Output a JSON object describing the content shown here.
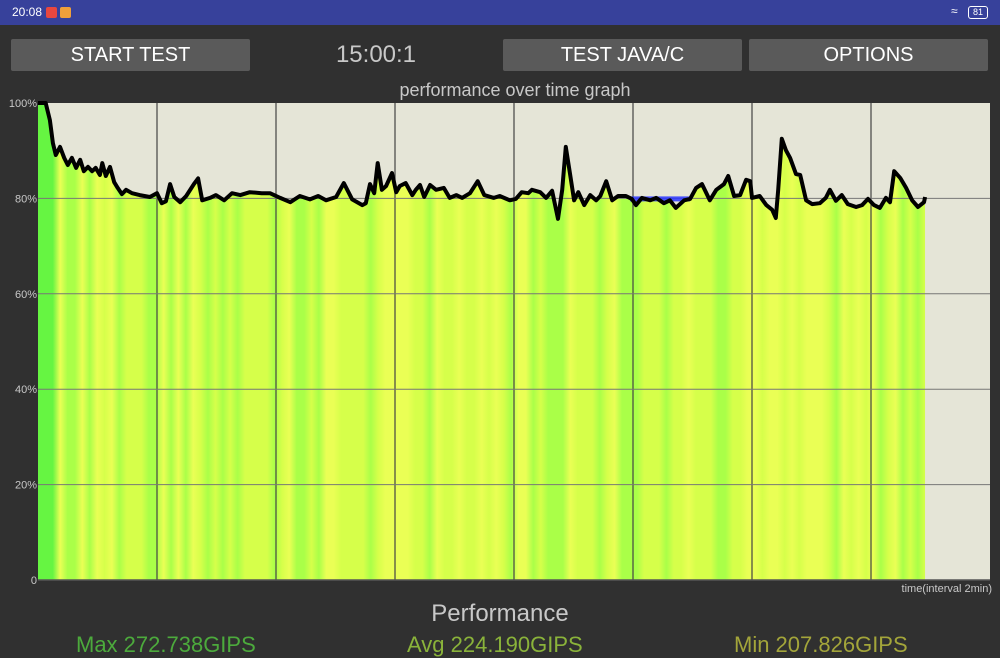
{
  "status_bar": {
    "time": "20:08",
    "battery": "81",
    "color": "#37419b"
  },
  "toolbar": {
    "start_label": "START TEST",
    "timer": "15:00:1",
    "test_label": "TEST JAVA/C",
    "options_label": "OPTIONS"
  },
  "chart_data": {
    "type": "area",
    "title": "performance over time graph",
    "xlabel": "time(interval 2min)",
    "x_unit": "min",
    "xlim": [
      0,
      16
    ],
    "x_grid_interval": 2,
    "ylim": [
      0,
      100
    ],
    "y_ticks": [
      0,
      20,
      40,
      60,
      80,
      100
    ],
    "y_tick_labels": [
      "0",
      "20%",
      "40%",
      "60%",
      "80%",
      "100%"
    ],
    "grid": true,
    "line_color": "#000000",
    "fill_colors": [
      "#66f542",
      "#d6ff4a",
      "#eaff55"
    ],
    "plot_background": "#e5e5d7",
    "highlight": {
      "x_range": [
        9.95,
        10.96
      ],
      "y": 80,
      "color": "#2a35ff"
    },
    "x": [
      0,
      0.13,
      0.2,
      0.25,
      0.3,
      0.37,
      0.44,
      0.5,
      0.57,
      0.64,
      0.71,
      0.77,
      0.84,
      0.91,
      0.97,
      1.04,
      1.08,
      1.14,
      1.21,
      1.28,
      1.34,
      1.41,
      1.48,
      1.58,
      1.71,
      1.88,
      2.0,
      2.08,
      2.15,
      2.22,
      2.29,
      2.39,
      2.49,
      2.62,
      2.69,
      2.76,
      2.89,
      2.99,
      3.13,
      3.26,
      3.4,
      3.56,
      3.76,
      3.9,
      4.07,
      4.24,
      4.4,
      4.57,
      4.71,
      4.84,
      5.01,
      5.14,
      5.28,
      5.45,
      5.51,
      5.58,
      5.65,
      5.71,
      5.78,
      5.85,
      5.95,
      6.02,
      6.08,
      6.18,
      6.29,
      6.35,
      6.42,
      6.49,
      6.59,
      6.69,
      6.82,
      6.92,
      7.03,
      7.13,
      7.26,
      7.39,
      7.5,
      7.66,
      7.76,
      7.93,
      8.03,
      8.13,
      8.24,
      8.3,
      8.44,
      8.54,
      8.64,
      8.74,
      8.81,
      8.87,
      8.94,
      9.01,
      9.08,
      9.18,
      9.28,
      9.38,
      9.45,
      9.55,
      9.65,
      9.75,
      9.88,
      9.98,
      10.05,
      10.15,
      10.29,
      10.39,
      10.52,
      10.62,
      10.72,
      10.86,
      10.96,
      11.06,
      11.16,
      11.29,
      11.4,
      11.53,
      11.6,
      11.7,
      11.8,
      11.9,
      11.97,
      12.0,
      12.13,
      12.24,
      12.34,
      12.4,
      12.44,
      12.5,
      12.57,
      12.64,
      12.74,
      12.81,
      12.91,
      13.01,
      13.14,
      13.24,
      13.31,
      13.41,
      13.51,
      13.61,
      13.75,
      13.85,
      13.95,
      14.05,
      14.15,
      14.25,
      14.32,
      14.39,
      14.49,
      14.59,
      14.69,
      14.79,
      14.89,
      14.91
    ],
    "y": [
      100,
      100,
      96.4,
      91.6,
      89.1,
      90.8,
      88.5,
      87.0,
      88.5,
      86.4,
      88.1,
      85.7,
      86.6,
      85.7,
      86.4,
      84.9,
      87.4,
      84.7,
      86.6,
      83.4,
      82.2,
      80.9,
      81.8,
      81.1,
      80.7,
      80.3,
      81.1,
      79.0,
      79.4,
      83.0,
      80.3,
      79.2,
      80.5,
      83.0,
      84.2,
      79.6,
      80.1,
      80.7,
      79.6,
      81.1,
      80.7,
      81.3,
      81.1,
      81.1,
      80.1,
      79.2,
      80.5,
      79.8,
      80.5,
      79.6,
      80.3,
      83.2,
      79.8,
      78.6,
      79.0,
      83.0,
      81.1,
      87.4,
      81.8,
      82.6,
      85.3,
      81.3,
      82.6,
      83.2,
      80.7,
      81.8,
      82.8,
      80.3,
      82.8,
      81.8,
      82.2,
      80.1,
      80.7,
      80.1,
      81.1,
      83.6,
      80.7,
      80.1,
      80.5,
      79.6,
      79.9,
      81.3,
      81.1,
      81.8,
      81.3,
      80.1,
      81.6,
      75.7,
      81.8,
      90.8,
      85.3,
      79.6,
      81.3,
      78.6,
      80.7,
      79.6,
      80.5,
      83.6,
      79.6,
      80.5,
      80.5,
      79.9,
      78.6,
      80.1,
      79.6,
      80.1,
      79.0,
      79.6,
      78.0,
      79.6,
      79.9,
      82.2,
      83.0,
      79.6,
      81.8,
      83.0,
      84.7,
      80.5,
      80.7,
      83.9,
      83.6,
      80.1,
      80.5,
      78.6,
      77.6,
      75.9,
      81.8,
      92.5,
      90.1,
      88.5,
      85.1,
      84.9,
      79.6,
      78.8,
      79.0,
      80.1,
      81.8,
      79.5,
      80.7,
      78.8,
      78.2,
      78.6,
      79.9,
      78.6,
      78.0,
      80.1,
      79.2,
      85.7,
      84.3,
      82.2,
      79.6,
      78.2,
      79.2,
      80.3
    ]
  },
  "summary": {
    "title": "Performance",
    "max": "Max 272.738GIPS",
    "avg": "Avg 224.190GIPS",
    "min": "Min 207.826GIPS",
    "max_color": "#4caa3c",
    "avg_color": "#8ab33a",
    "min_color": "#a3a53a"
  }
}
